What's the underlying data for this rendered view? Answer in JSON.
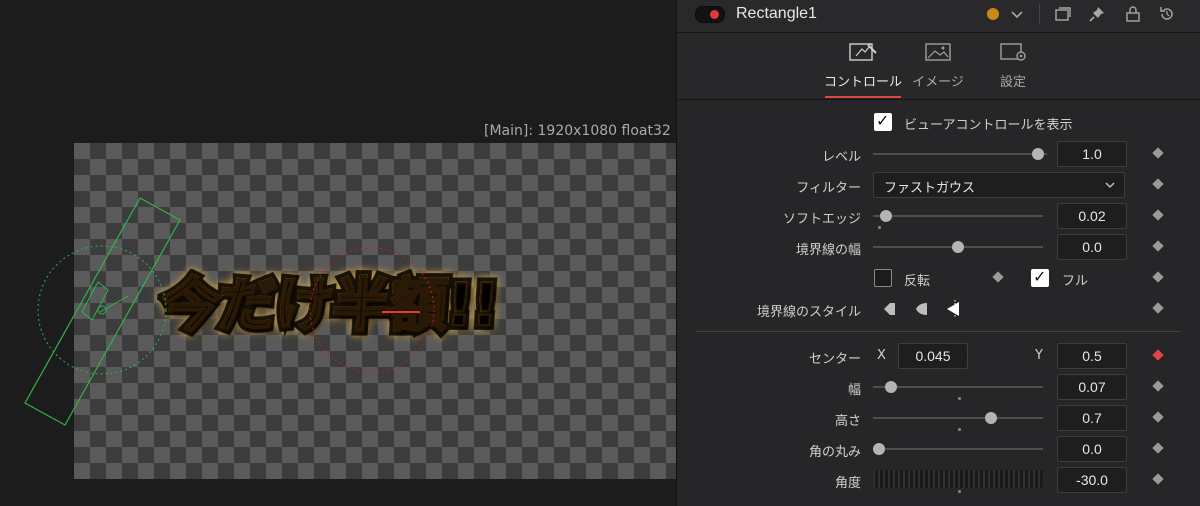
{
  "viewer": {
    "label": "[Main]: 1920x1080 float32",
    "overlay_text": "今だけ半額!!"
  },
  "node": {
    "name": "Rectangle1",
    "enabled": true,
    "color": "#c98a12"
  },
  "tabs": [
    {
      "label": "コントロール",
      "icon": "controls-icon",
      "active": true
    },
    {
      "label": "イメージ",
      "icon": "image-icon",
      "active": false
    },
    {
      "label": "設定",
      "icon": "settings-icon",
      "active": false
    }
  ],
  "controls": {
    "show_viewer_controls": {
      "label": "ビューアコントロールを表示",
      "checked": true
    },
    "level": {
      "label": "レベル",
      "value": "1.0",
      "position": 0.95
    },
    "filter": {
      "label": "フィルター",
      "value": "ファストガウス"
    },
    "soft_edge": {
      "label": "ソフトエッジ",
      "value": "0.02",
      "position": 0.02
    },
    "border_width": {
      "label": "境界線の幅",
      "value": "0.0",
      "position": 0.5
    },
    "invert": {
      "label": "反転",
      "checked": false
    },
    "solid": {
      "label": "フル",
      "checked": true
    },
    "border_style": {
      "label": "境界線のスタイル",
      "icons": [
        "join-bevel-icon",
        "join-round-icon",
        "join-miter-icon"
      ]
    },
    "center": {
      "label": "センター",
      "x_label": "X",
      "x_value": "0.045",
      "y_label": "Y",
      "y_value": "0.5"
    },
    "width": {
      "label": "幅",
      "value": "0.07",
      "position": 0.07
    },
    "height": {
      "label": "高さ",
      "value": "0.7",
      "position": 0.7
    },
    "corner_radius": {
      "label": "角の丸み",
      "value": "0.0",
      "position": 0.0
    },
    "angle": {
      "label": "角度",
      "value": "-30.0"
    }
  },
  "colors": {
    "accent": "#e24545",
    "panel": "#262628",
    "viewer_bg": "#1c1c1c"
  }
}
